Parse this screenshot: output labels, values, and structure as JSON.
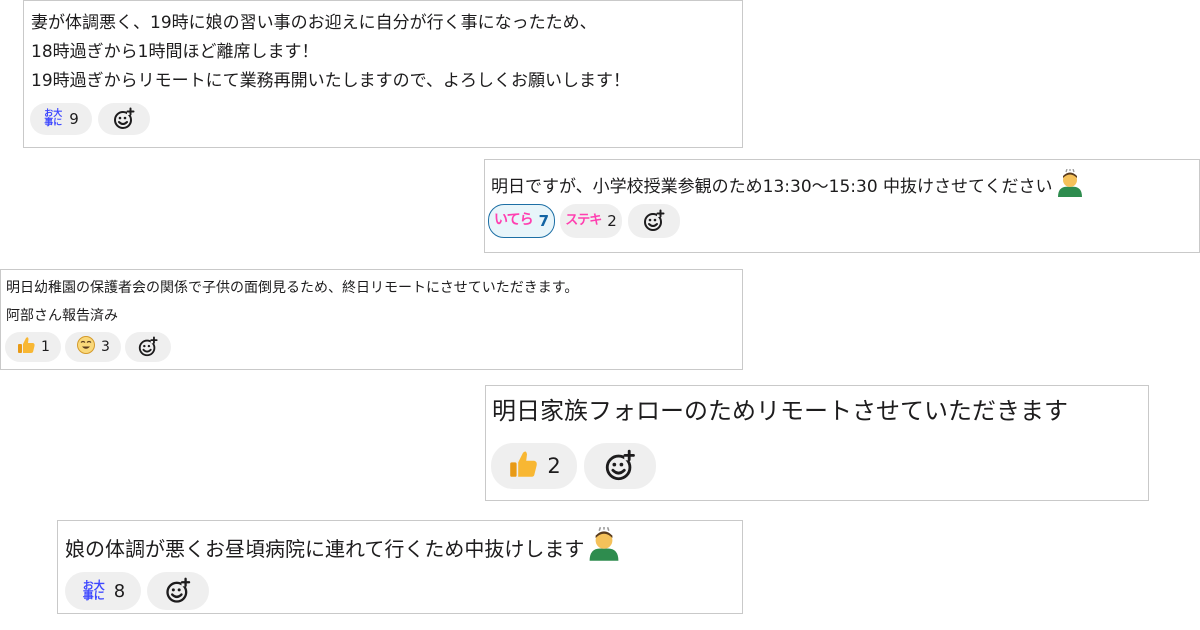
{
  "colors": {
    "chip_bg": "#efefef",
    "selected_chip_bg": "#e8f5fa",
    "selected_chip_border": "#1d6fa5",
    "stamp_blue": "#3f49ff",
    "stamp_magenta": "#ff3fb0",
    "card_border": "#c9c9c9"
  },
  "messages": [
    {
      "lines": [
        "妻が体調悪く、19時に娘の習い事のお迎えに自分が行く事になったため、",
        "18時過ぎから1時間ほど離席します！",
        "19時過ぎからリモートにて業務再開いたしますので、よろしくお願いします！"
      ],
      "reactions": [
        {
          "emoji": "odaijini",
          "stamp_text": "お大事に",
          "count": "9"
        }
      ]
    },
    {
      "lines": [
        "明日ですが、小学校授業参観のため13:30〜15:30 中抜けさせてください"
      ],
      "trailing_emoji": "bowing-man-emoji",
      "reactions": [
        {
          "emoji": "itera",
          "stamp_text": "いてら",
          "count": "7",
          "selected": true
        },
        {
          "emoji": "suteki",
          "stamp_text": "ステキ",
          "count": "2"
        }
      ]
    },
    {
      "lines": [
        "明日幼稚園の保護者会の関係で子供の面倒見るため、終日リモートにさせていただきます。",
        "阿部さん報告済み"
      ],
      "reactions": [
        {
          "emoji": "thumbsup",
          "count": "1"
        },
        {
          "emoji": "smiling-face",
          "count": "3"
        }
      ]
    },
    {
      "lines": [
        "明日家族フォローのためリモートさせていただきます"
      ],
      "reactions": [
        {
          "emoji": "thumbsup",
          "count": "2"
        }
      ]
    },
    {
      "lines": [
        "娘の体調が悪くお昼頃病院に連れて行くため中抜けします"
      ],
      "trailing_emoji": "bowing-man-emoji",
      "reactions": [
        {
          "emoji": "odaijini",
          "stamp_text": "お大事に",
          "count": "8"
        }
      ]
    }
  ],
  "add_reaction_icon": "add-reaction-icon"
}
